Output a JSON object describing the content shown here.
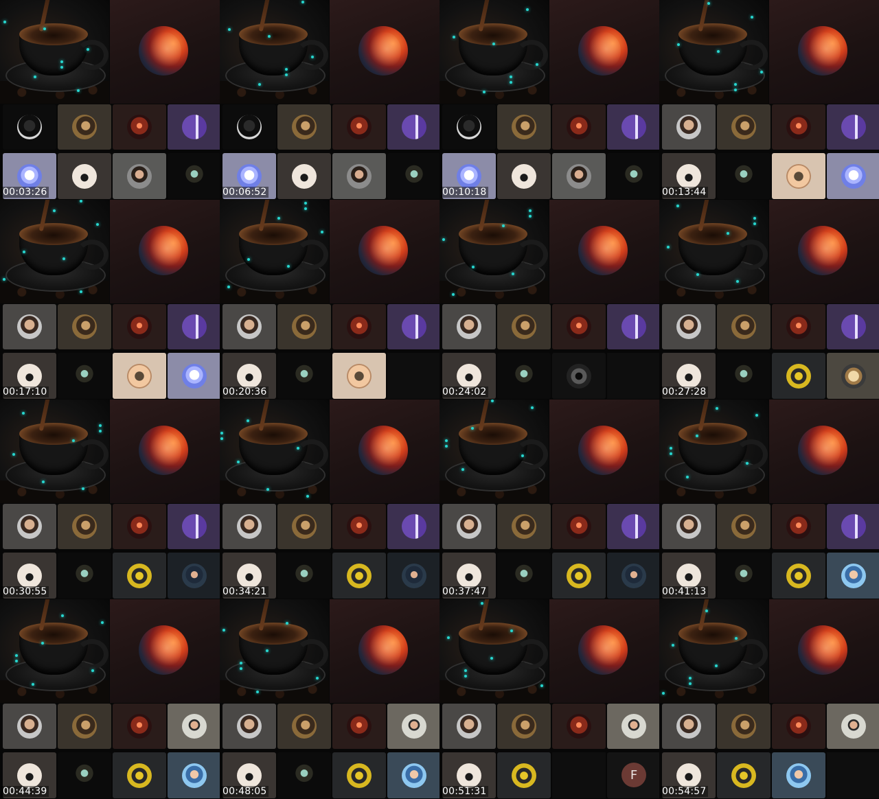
{
  "timestamps": [
    "00:03:26",
    "00:06:52",
    "00:10:18",
    "00:13:44",
    "00:17:10",
    "00:20:36",
    "00:24:02",
    "00:27:28",
    "00:30:55",
    "00:34:21",
    "00:37:47",
    "00:41:13",
    "00:44:39",
    "00:48:05",
    "00:51:31",
    "00:54:57"
  ],
  "participant_initial": "F",
  "frames": [
    {
      "r1": [
        "hood",
        "amber",
        "red",
        "purple"
      ],
      "r2": [
        "eagle",
        "light",
        "beard",
        "figure"
      ]
    },
    {
      "r1": [
        "hood",
        "amber",
        "red",
        "purple"
      ],
      "r2": [
        "eagle",
        "light",
        "beard",
        "figure"
      ]
    },
    {
      "r1": [
        "hood",
        "amber",
        "red",
        "purple"
      ],
      "r2": [
        "eagle",
        "light",
        "beard",
        "figure"
      ]
    },
    {
      "r1": [
        "stubble",
        "amber",
        "red",
        "purple"
      ],
      "r2": [
        "light",
        "figure",
        "dragon",
        "eagle"
      ]
    },
    {
      "r1": [
        "stubble",
        "amber",
        "red",
        "purple"
      ],
      "r2": [
        "light",
        "figure",
        "dragon",
        "eagle"
      ]
    },
    {
      "r1": [
        "stubble",
        "amber",
        "red",
        "purple"
      ],
      "r2": [
        "light",
        "figure",
        "dragon",
        null
      ]
    },
    {
      "r1": [
        "stubble",
        "amber",
        "red",
        "purple"
      ],
      "r2": [
        "light",
        "figure",
        "badge",
        null
      ]
    },
    {
      "r1": [
        "stubble",
        "amber",
        "red",
        "purple"
      ],
      "r2": [
        "light",
        "figure",
        "yellow",
        "box"
      ]
    },
    {
      "r1": [
        "stubble",
        "amber",
        "red",
        "purple"
      ],
      "r2": [
        "light",
        "figure",
        "yellow",
        "cap"
      ]
    },
    {
      "r1": [
        "stubble",
        "amber",
        "red",
        "purple"
      ],
      "r2": [
        "light",
        "figure",
        "yellow",
        "cap"
      ]
    },
    {
      "r1": [
        "stubble",
        "amber",
        "red",
        "purple"
      ],
      "r2": [
        "light",
        "figure",
        "yellow",
        "cap"
      ]
    },
    {
      "r1": [
        "stubble",
        "amber",
        "red",
        "purple"
      ],
      "r2": [
        "light",
        "figure",
        "yellow",
        "blue"
      ]
    },
    {
      "r1": [
        "stubble",
        "amber",
        "red",
        "glasses"
      ],
      "r2": [
        "light",
        "figure",
        "yellow",
        "blue"
      ]
    },
    {
      "r1": [
        "stubble",
        "amber",
        "red",
        "glasses"
      ],
      "r2": [
        "light",
        "figure",
        "yellow",
        "blue"
      ]
    },
    {
      "r1": [
        "stubble",
        "amber",
        "red",
        "glasses"
      ],
      "r2": [
        "light",
        "yellow",
        null,
        "letter"
      ]
    },
    {
      "r1": [
        "stubble",
        "amber",
        "red",
        "glasses"
      ],
      "r2": [
        "light",
        "yellow",
        "blue",
        null
      ]
    }
  ]
}
